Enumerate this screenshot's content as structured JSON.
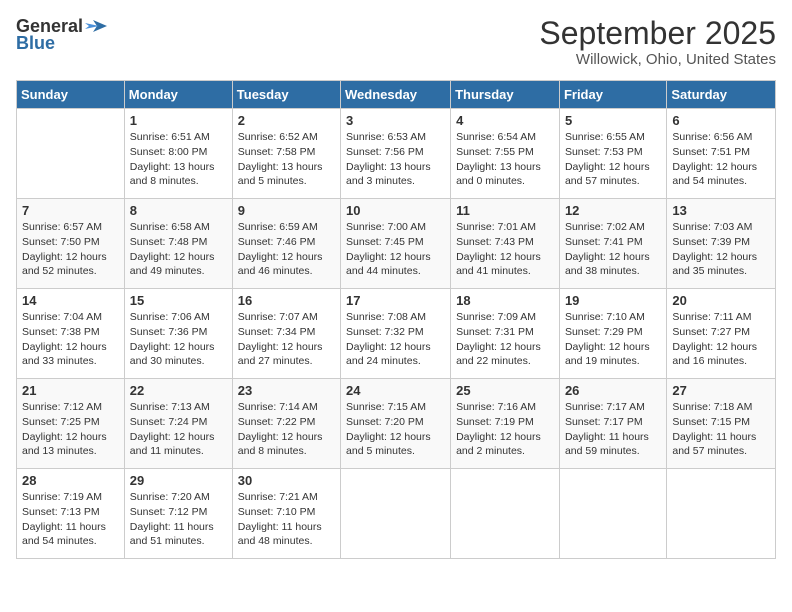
{
  "logo": {
    "general": "General",
    "blue": "Blue"
  },
  "title": "September 2025",
  "location": "Willowick, Ohio, United States",
  "days_of_week": [
    "Sunday",
    "Monday",
    "Tuesday",
    "Wednesday",
    "Thursday",
    "Friday",
    "Saturday"
  ],
  "weeks": [
    [
      {
        "num": "",
        "sunrise": "",
        "sunset": "",
        "daylight": ""
      },
      {
        "num": "1",
        "sunrise": "Sunrise: 6:51 AM",
        "sunset": "Sunset: 8:00 PM",
        "daylight": "Daylight: 13 hours and 8 minutes."
      },
      {
        "num": "2",
        "sunrise": "Sunrise: 6:52 AM",
        "sunset": "Sunset: 7:58 PM",
        "daylight": "Daylight: 13 hours and 5 minutes."
      },
      {
        "num": "3",
        "sunrise": "Sunrise: 6:53 AM",
        "sunset": "Sunset: 7:56 PM",
        "daylight": "Daylight: 13 hours and 3 minutes."
      },
      {
        "num": "4",
        "sunrise": "Sunrise: 6:54 AM",
        "sunset": "Sunset: 7:55 PM",
        "daylight": "Daylight: 13 hours and 0 minutes."
      },
      {
        "num": "5",
        "sunrise": "Sunrise: 6:55 AM",
        "sunset": "Sunset: 7:53 PM",
        "daylight": "Daylight: 12 hours and 57 minutes."
      },
      {
        "num": "6",
        "sunrise": "Sunrise: 6:56 AM",
        "sunset": "Sunset: 7:51 PM",
        "daylight": "Daylight: 12 hours and 54 minutes."
      }
    ],
    [
      {
        "num": "7",
        "sunrise": "Sunrise: 6:57 AM",
        "sunset": "Sunset: 7:50 PM",
        "daylight": "Daylight: 12 hours and 52 minutes."
      },
      {
        "num": "8",
        "sunrise": "Sunrise: 6:58 AM",
        "sunset": "Sunset: 7:48 PM",
        "daylight": "Daylight: 12 hours and 49 minutes."
      },
      {
        "num": "9",
        "sunrise": "Sunrise: 6:59 AM",
        "sunset": "Sunset: 7:46 PM",
        "daylight": "Daylight: 12 hours and 46 minutes."
      },
      {
        "num": "10",
        "sunrise": "Sunrise: 7:00 AM",
        "sunset": "Sunset: 7:45 PM",
        "daylight": "Daylight: 12 hours and 44 minutes."
      },
      {
        "num": "11",
        "sunrise": "Sunrise: 7:01 AM",
        "sunset": "Sunset: 7:43 PM",
        "daylight": "Daylight: 12 hours and 41 minutes."
      },
      {
        "num": "12",
        "sunrise": "Sunrise: 7:02 AM",
        "sunset": "Sunset: 7:41 PM",
        "daylight": "Daylight: 12 hours and 38 minutes."
      },
      {
        "num": "13",
        "sunrise": "Sunrise: 7:03 AM",
        "sunset": "Sunset: 7:39 PM",
        "daylight": "Daylight: 12 hours and 35 minutes."
      }
    ],
    [
      {
        "num": "14",
        "sunrise": "Sunrise: 7:04 AM",
        "sunset": "Sunset: 7:38 PM",
        "daylight": "Daylight: 12 hours and 33 minutes."
      },
      {
        "num": "15",
        "sunrise": "Sunrise: 7:06 AM",
        "sunset": "Sunset: 7:36 PM",
        "daylight": "Daylight: 12 hours and 30 minutes."
      },
      {
        "num": "16",
        "sunrise": "Sunrise: 7:07 AM",
        "sunset": "Sunset: 7:34 PM",
        "daylight": "Daylight: 12 hours and 27 minutes."
      },
      {
        "num": "17",
        "sunrise": "Sunrise: 7:08 AM",
        "sunset": "Sunset: 7:32 PM",
        "daylight": "Daylight: 12 hours and 24 minutes."
      },
      {
        "num": "18",
        "sunrise": "Sunrise: 7:09 AM",
        "sunset": "Sunset: 7:31 PM",
        "daylight": "Daylight: 12 hours and 22 minutes."
      },
      {
        "num": "19",
        "sunrise": "Sunrise: 7:10 AM",
        "sunset": "Sunset: 7:29 PM",
        "daylight": "Daylight: 12 hours and 19 minutes."
      },
      {
        "num": "20",
        "sunrise": "Sunrise: 7:11 AM",
        "sunset": "Sunset: 7:27 PM",
        "daylight": "Daylight: 12 hours and 16 minutes."
      }
    ],
    [
      {
        "num": "21",
        "sunrise": "Sunrise: 7:12 AM",
        "sunset": "Sunset: 7:25 PM",
        "daylight": "Daylight: 12 hours and 13 minutes."
      },
      {
        "num": "22",
        "sunrise": "Sunrise: 7:13 AM",
        "sunset": "Sunset: 7:24 PM",
        "daylight": "Daylight: 12 hours and 11 minutes."
      },
      {
        "num": "23",
        "sunrise": "Sunrise: 7:14 AM",
        "sunset": "Sunset: 7:22 PM",
        "daylight": "Daylight: 12 hours and 8 minutes."
      },
      {
        "num": "24",
        "sunrise": "Sunrise: 7:15 AM",
        "sunset": "Sunset: 7:20 PM",
        "daylight": "Daylight: 12 hours and 5 minutes."
      },
      {
        "num": "25",
        "sunrise": "Sunrise: 7:16 AM",
        "sunset": "Sunset: 7:19 PM",
        "daylight": "Daylight: 12 hours and 2 minutes."
      },
      {
        "num": "26",
        "sunrise": "Sunrise: 7:17 AM",
        "sunset": "Sunset: 7:17 PM",
        "daylight": "Daylight: 11 hours and 59 minutes."
      },
      {
        "num": "27",
        "sunrise": "Sunrise: 7:18 AM",
        "sunset": "Sunset: 7:15 PM",
        "daylight": "Daylight: 11 hours and 57 minutes."
      }
    ],
    [
      {
        "num": "28",
        "sunrise": "Sunrise: 7:19 AM",
        "sunset": "Sunset: 7:13 PM",
        "daylight": "Daylight: 11 hours and 54 minutes."
      },
      {
        "num": "29",
        "sunrise": "Sunrise: 7:20 AM",
        "sunset": "Sunset: 7:12 PM",
        "daylight": "Daylight: 11 hours and 51 minutes."
      },
      {
        "num": "30",
        "sunrise": "Sunrise: 7:21 AM",
        "sunset": "Sunset: 7:10 PM",
        "daylight": "Daylight: 11 hours and 48 minutes."
      },
      {
        "num": "",
        "sunrise": "",
        "sunset": "",
        "daylight": ""
      },
      {
        "num": "",
        "sunrise": "",
        "sunset": "",
        "daylight": ""
      },
      {
        "num": "",
        "sunrise": "",
        "sunset": "",
        "daylight": ""
      },
      {
        "num": "",
        "sunrise": "",
        "sunset": "",
        "daylight": ""
      }
    ]
  ]
}
